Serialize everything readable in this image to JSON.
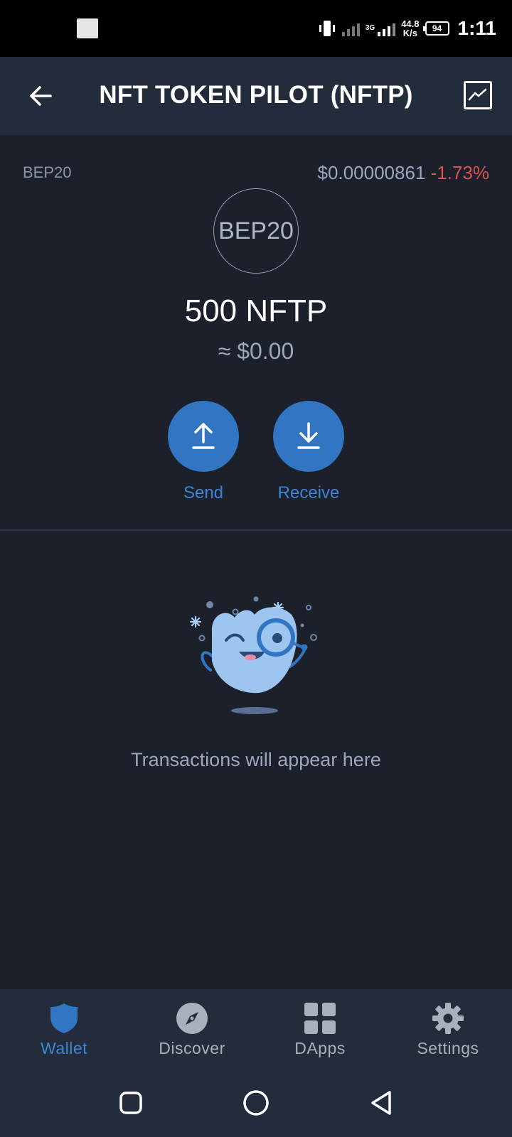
{
  "status_bar": {
    "net_type": "3G",
    "speed_value": "44.8",
    "speed_unit": "K/s",
    "battery": "94",
    "time": "1:11"
  },
  "header": {
    "title": "NFT TOKEN PILOT (NFTP)",
    "back_icon": "arrow-left-icon",
    "chart_icon": "line-chart-icon"
  },
  "token": {
    "network": "BEP20",
    "price": "$0.00000861",
    "change": "-1.73%",
    "logo_text": "BEP20",
    "balance": "500 NFTP",
    "fiat_value": "≈ $0.00"
  },
  "actions": {
    "send_label": "Send",
    "receive_label": "Receive"
  },
  "empty_state": {
    "message": "Transactions will appear here"
  },
  "bottom_nav": {
    "items": [
      {
        "label": "Wallet",
        "icon": "shield-icon",
        "active": true
      },
      {
        "label": "Discover",
        "icon": "compass-icon",
        "active": false
      },
      {
        "label": "DApps",
        "icon": "grid-icon",
        "active": false
      },
      {
        "label": "Settings",
        "icon": "gear-icon",
        "active": false
      }
    ]
  },
  "colors": {
    "background": "#1b202b",
    "header": "#232c3a",
    "accent": "#3275c3",
    "negative": "#d9534f"
  }
}
